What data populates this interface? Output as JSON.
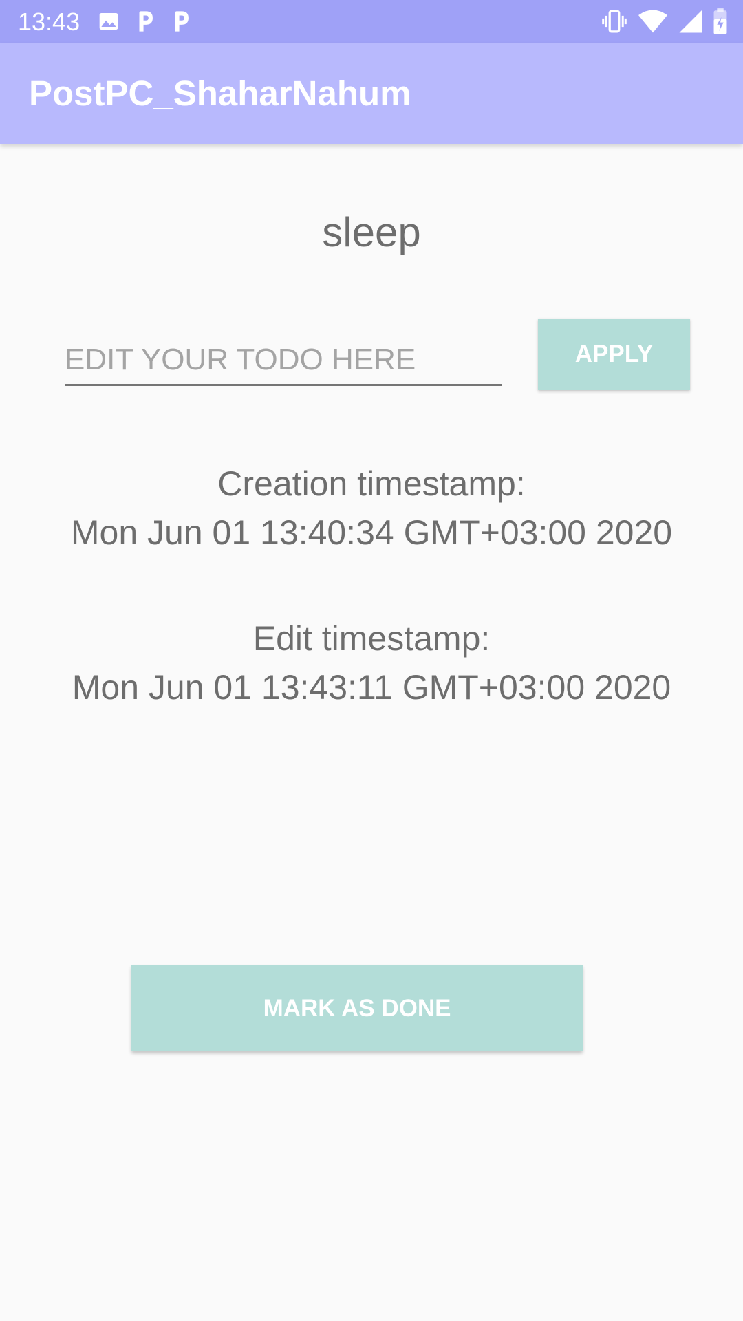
{
  "status_bar": {
    "time": "13:43",
    "left_icons": [
      "image-icon",
      "parking-p-icon",
      "parking-p-icon"
    ],
    "right_icons": [
      "vibrate-icon",
      "wifi-icon",
      "signal-icon",
      "battery-charging-icon"
    ],
    "background": "#9fa1f7"
  },
  "app_bar": {
    "title": "PostPC_ShaharNahum",
    "background": "#b8b9fd"
  },
  "todo": {
    "title": "sleep",
    "input_value": "",
    "input_placeholder": "EDIT YOUR TODO HERE",
    "apply_label": "APPLY",
    "creation_label": "Creation timestamp:",
    "creation_value": "Mon Jun 01 13:40:34 GMT+03:00 2020",
    "edit_label": "Edit timestamp:",
    "edit_value": "Mon Jun 01 13:43:11 GMT+03:00 2020",
    "done_label": "MARK AS DONE"
  },
  "colors": {
    "button_bg": "#b3ddd8",
    "text": "#6d6d6d",
    "page_bg": "#fafafa"
  }
}
